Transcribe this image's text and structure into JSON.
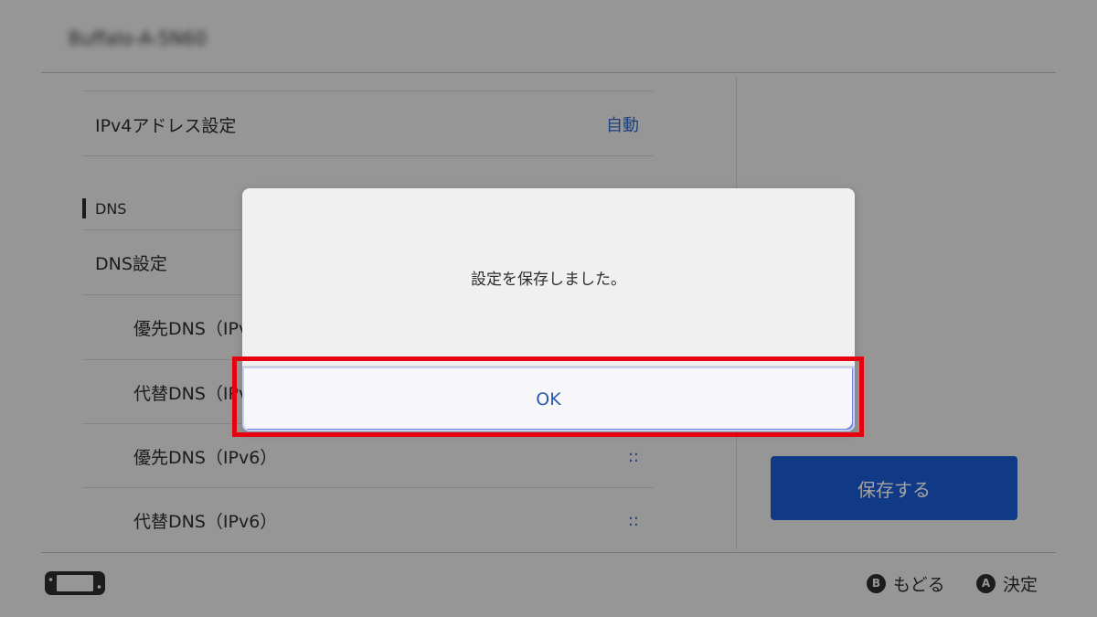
{
  "header": {
    "title": "Buffalo-A-5N60"
  },
  "settings": {
    "ipv4": {
      "label": "IPv4アドレス設定",
      "value": "自動"
    },
    "dns_section": {
      "title": "DNS"
    },
    "dns_setting": {
      "label": "DNS設定"
    },
    "primary_dns_v4": {
      "label": "優先DNS（IPv4）"
    },
    "secondary_dns_v4": {
      "label": "代替DNS（IPv4）"
    },
    "primary_dns_v6": {
      "label": "優先DNS（IPv6）",
      "value": "::"
    },
    "secondary_dns_v6": {
      "label": "代替DNS（IPv6）",
      "value": "::"
    }
  },
  "side": {
    "save_label": "保存する"
  },
  "footer": {
    "back": {
      "glyph": "B",
      "label": "もどる"
    },
    "confirm": {
      "glyph": "A",
      "label": "決定"
    }
  },
  "dialog": {
    "message": "設定を保存しました。",
    "ok_label": "OK"
  },
  "colors": {
    "accent": "#1a5ad2",
    "highlight": "#e60012",
    "value_text": "#2a66c9"
  }
}
